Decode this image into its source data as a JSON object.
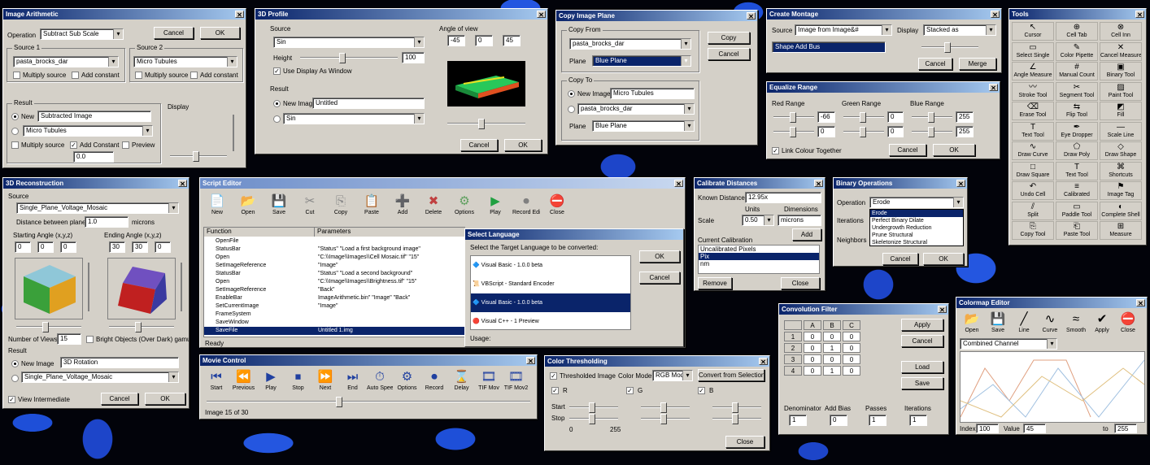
{
  "image_arithmetic": {
    "title": "Image Arithmetic",
    "operation_label": "Operation",
    "operation_value": "Subtract Sub Scale",
    "cancel": "Cancel",
    "ok": "OK",
    "source1_label": "Source 1",
    "source1_value": "pasta_brocks_dar",
    "source2_label": "Source 2",
    "source2_value": "Micro Tubules",
    "multiply_label": "Multiply source",
    "add_label": "Add constant",
    "result_label": "Result",
    "result_new": "New",
    "result_new_value": "Subtracted Image",
    "result_existing": "Micro Tubules",
    "multiply_source": "Multiply source",
    "add_constant": "Add Constant",
    "preview": "Preview",
    "constant_value": "0.0",
    "display_label": "Display"
  },
  "profile3d": {
    "title": "3D Profile",
    "source_label": "Source",
    "source_value": "Sin",
    "height_label": "Height",
    "height_value": "100",
    "use_display": "Use Display As Window",
    "result_label": "Result",
    "new_image": "New Image",
    "new_image_value": "Untitled",
    "existing_value": "Sin",
    "angle_label": "Angle of view",
    "angles": [
      "-45",
      "0",
      "45"
    ],
    "cancel": "Cancel",
    "ok": "OK"
  },
  "copy_image_plane": {
    "title": "Copy Image Plane",
    "copy_from": "Copy From",
    "from_value": "pasta_brocks_dar",
    "plane_label": "Plane",
    "plane_value": "Blue Plane",
    "copy": "Copy",
    "cancel": "Cancel",
    "copy_to": "Copy To",
    "new_image": "New Image",
    "new_image_value": "Micro Tubules",
    "existing_value": "pasta_brocks_dar",
    "plane2_value": "Blue Plane"
  },
  "create_montage": {
    "title": "Create Montage",
    "source_label": "Source",
    "source_value": "Image from Image&#",
    "display_label": "Display",
    "display_value": "Stacked as",
    "selected_row": "Shape Add Bus",
    "cancel": "Cancel",
    "merge": "Merge"
  },
  "equalize_range": {
    "title": "Equalize Range",
    "groups": [
      "Red Range",
      "Green Range",
      "Blue Range"
    ],
    "values": [
      "-66",
      "0",
      "255",
      "0",
      "0",
      "255"
    ],
    "link": "Link Colour Together",
    "cancel": "Cancel",
    "ok": "OK"
  },
  "tools": {
    "title": "Tools",
    "items": [
      "Cursor",
      "Cell Tab",
      "Cell Inn",
      "Select Single",
      "Color Pipette",
      "Cancel Measure",
      "Angle Measure",
      "Manual Count",
      "Binary Tool",
      "Stroke Tool",
      "Segment Tool",
      "Paint Tool",
      "Erase Tool",
      "Flip Tool",
      "Fill",
      "Text Tool",
      "Eye Dropper",
      "Scale Line",
      "Draw Curve",
      "Draw Poly",
      "Draw Shape",
      "Draw Square",
      "Text Tool",
      "Shortcuts",
      "Undo Cell",
      "Calibrated",
      "Image Tag",
      "Split",
      "Paddle Tool",
      "Complete Shell",
      "Copy Tool",
      "Paste Tool",
      "Measure"
    ]
  },
  "reconstruct3d": {
    "title": "3D Reconstruction",
    "source_label": "Source",
    "source_value": "Single_Plane_Voltage_Mosaic",
    "distance_label": "Distance between planes",
    "distance_value": "1.0",
    "distance_unit": "microns",
    "start_label": "Starting Angle (x,y,z)",
    "start_values": [
      "0",
      "0",
      "0"
    ],
    "ending_label": "Ending Angle (x,y,z)",
    "ending_values": [
      "30",
      "30",
      "0"
    ],
    "views_label": "Number of Views",
    "views_value": "15",
    "bright_label": "Bright Objects (Over Dark) gamut",
    "result_label": "Result",
    "new_image": "New Image",
    "new_image_value": "3D Rotation",
    "existing_value": "Single_Plane_Voltage_Mosaic",
    "view_intermediate": "View Intermediate",
    "cancel": "Cancel",
    "ok": "OK"
  },
  "script_editor": {
    "title": "Script Editor",
    "toolbar": [
      "New",
      "Open",
      "Save",
      "Cut",
      "Copy",
      "Paste",
      "Add",
      "Delete",
      "Options",
      "Play",
      "Record Edit",
      "Close"
    ],
    "col_function": "Function",
    "col_parameters": "Parameters",
    "rows": [
      [
        "OpenFile",
        ""
      ],
      [
        "StatusBar",
        "\"Status\" \"Load a first background image\""
      ],
      [
        "Open",
        "\"C:\\\\Image\\\\Images\\\\Cell Mosaic.tif\" \"15\""
      ],
      [
        "SetImageReference",
        "\"Image\""
      ],
      [
        "StatusBar",
        "\"Status\" \"Load a second background\""
      ],
      [
        "Open",
        "\"C:\\\\Image\\\\Images\\\\Brightness.tif\" \"15\""
      ],
      [
        "SetImageReference",
        "\"Back\""
      ],
      [
        "EnableBar",
        "ImageArithmetic.bin\" \"Image\" \"Back\""
      ],
      [
        "SetCurrentImage",
        "\"Image\""
      ],
      [
        "FrameSystem",
        ""
      ],
      [
        "SaveWindow",
        ""
      ],
      [
        "SaveFile",
        "Untitled 1.img"
      ]
    ],
    "status": "Ready"
  },
  "select_language": {
    "title": "Select Language",
    "prompt": "Select the Target Language to be converted:",
    "items": [
      "Visual Basic - 1.0.0 beta",
      "VBScript - Standard Encoder",
      "Visual Basic - 1.0.0 beta",
      "Visual C++ - 1 Preview"
    ],
    "ok": "OK",
    "cancel": "Cancel",
    "footer": "Usage:"
  },
  "calibrate_distance": {
    "title": "Calibrate Distances",
    "label_known": "Known Distance",
    "known_value": "12.95x",
    "unit_label": "Units",
    "unit_value": "Dimensions",
    "scale_label": "Scale",
    "scale_value": "0.50",
    "scale_unit": "microns",
    "add": "Add",
    "current_cal": "Current Calibration",
    "cal_items": [
      "Uncalibrated Pixels",
      "Pix",
      "nm"
    ],
    "selected_cal": "Pix",
    "remove": "Remove",
    "close": "Close"
  },
  "binary_operations": {
    "title": "Binary Operations",
    "operation_label": "Operation",
    "operation_value": "Erode",
    "options": [
      "Erode",
      "Perfect Binary Dilate",
      "Undergrowth Reduction",
      "Prune Structural",
      "Skeletonize Structural"
    ],
    "iterations_label": "Iterations",
    "iterations_value": "1",
    "neighbors_label": "Neighbors",
    "cancel": "Cancel",
    "ok": "OK"
  },
  "movie_control": {
    "title": "Movie Control",
    "buttons": [
      "Start",
      "Previous",
      "Play",
      "Stop",
      "Next",
      "End",
      "Auto Speed",
      "Options",
      "Record",
      "Delay",
      "TIF Mov",
      "TIF Mov2"
    ],
    "status": "Image 15 of 30"
  },
  "color_thresholding": {
    "title": "Color Thresholding",
    "preview_label": "Thresholded Image",
    "color_model_label": "Color Model",
    "color_model_value": "RGB Model",
    "setup_button": "Convert from Selection",
    "channel_labels": [
      "R",
      "G",
      "B"
    ],
    "min_label": "Start",
    "max_label": "Stop",
    "scale_min": "0",
    "scale_max": "255",
    "close": "Close"
  },
  "convolution_filter": {
    "title": "Convolution Filter",
    "headers": [
      "",
      "A",
      "B",
      "C"
    ],
    "rows": [
      [
        "1",
        "0",
        "0",
        "0"
      ],
      [
        "2",
        "0",
        "1",
        "0"
      ],
      [
        "3",
        "0",
        "0",
        "0"
      ],
      [
        "4",
        "0",
        "1",
        "0"
      ]
    ],
    "apply": "Apply",
    "cancel": "Cancel",
    "load": "Load",
    "save": "Save",
    "divisor_label": "Denominator",
    "offset_label": "Add Bias",
    "passes_label": "Passes",
    "iterations_label": "Iterations",
    "divisor_value": "1",
    "offset_value": "0",
    "passes_value": "1",
    "iterations_value": "1"
  },
  "colormap_editor": {
    "title": "Colormap Editor",
    "tools": [
      "Open",
      "Save",
      "Line",
      "Curve",
      "Smooth",
      "Apply",
      "Close"
    ],
    "channel_value": "Combined Channel",
    "index_label": "Index",
    "index_value": "100",
    "value_label": "Value",
    "value_value": "45",
    "to_label": "to",
    "to_value": "255"
  }
}
